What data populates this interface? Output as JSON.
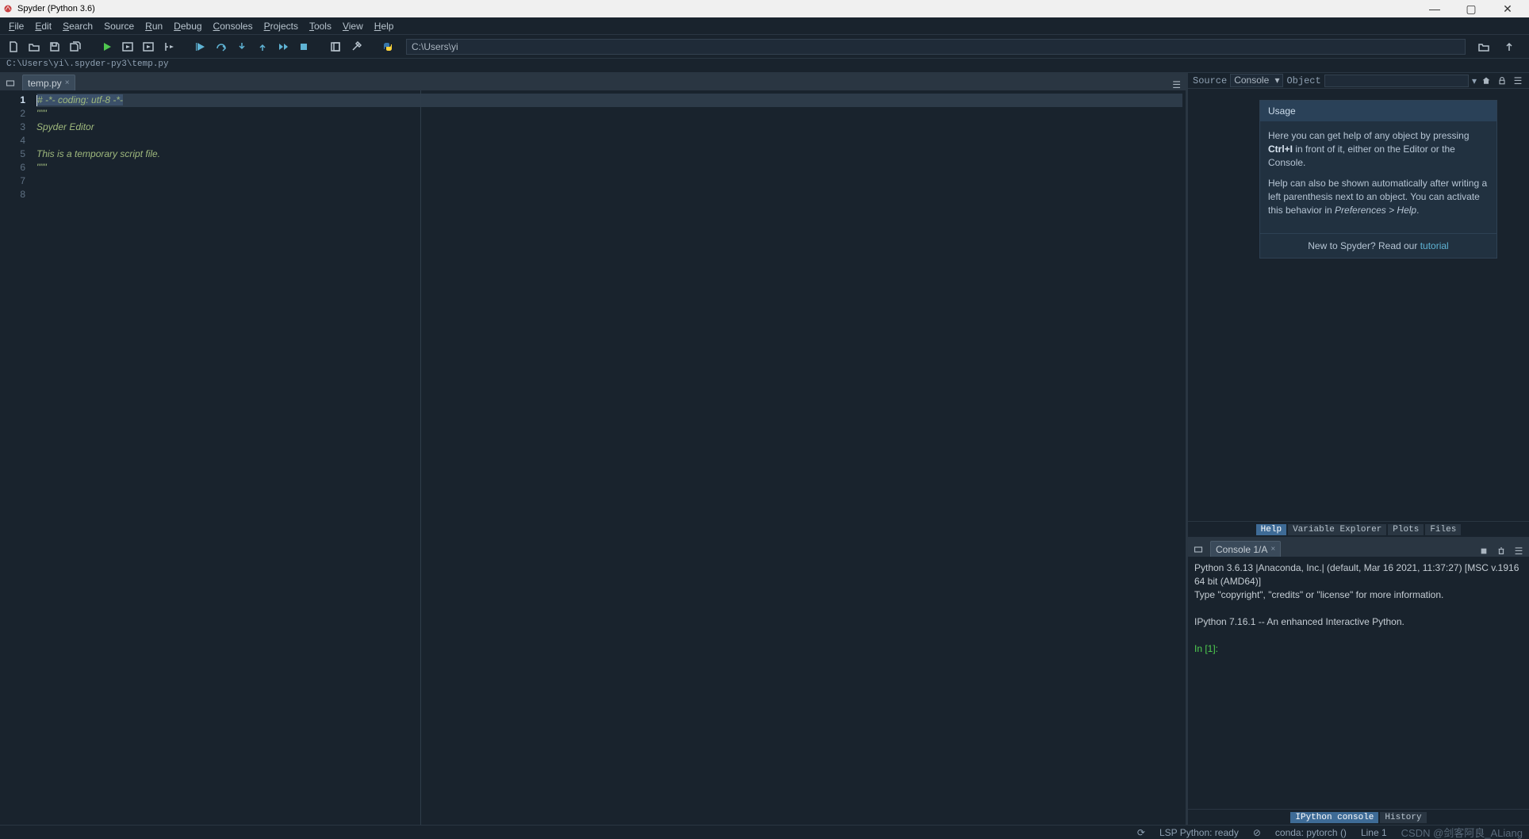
{
  "window": {
    "title": "Spyder (Python 3.6)",
    "minimize_label": "—",
    "maximize_label": "▢",
    "close_label": "✕"
  },
  "menubar": [
    {
      "key": "F",
      "rest": "ile"
    },
    {
      "key": "E",
      "rest": "dit"
    },
    {
      "key": "S",
      "rest": "earch"
    },
    {
      "key": "",
      "rest": "Source"
    },
    {
      "key": "R",
      "rest": "un"
    },
    {
      "key": "D",
      "rest": "ebug"
    },
    {
      "key": "C",
      "rest": "onsoles"
    },
    {
      "key": "P",
      "rest": "rojects"
    },
    {
      "key": "T",
      "rest": "ools"
    },
    {
      "key": "V",
      "rest": "iew"
    },
    {
      "key": "H",
      "rest": "elp"
    }
  ],
  "toolbar": {
    "working_dir": "C:\\Users\\yi"
  },
  "current_file_path": "C:\\Users\\yi\\.spyder-py3\\temp.py",
  "editor": {
    "tab_label": "temp.py",
    "tab_close": "×",
    "line_numbers": [
      "1",
      "2",
      "3",
      "4",
      "5",
      "6",
      "7",
      "8"
    ],
    "lines": [
      "# -*- coding: utf-8 -*-",
      "\"\"\"",
      "Spyder Editor",
      "",
      "This is a temporary script file.",
      "\"\"\"",
      "",
      ""
    ]
  },
  "help": {
    "source_label": "Source",
    "source_value": "Console",
    "object_label": "Object",
    "usage_title": "Usage",
    "usage_text1_pre": "Here you can get help of any object by pressing ",
    "usage_text1_key": "Ctrl+I",
    "usage_text1_post": " in front of it, either on the Editor or the Console.",
    "usage_text2_pre": "Help can also be shown automatically after writing a left parenthesis next to an object. You can activate this behavior in ",
    "usage_text2_pref": "Preferences > Help",
    "usage_text2_end": ".",
    "footer_pre": "New to Spyder? Read our ",
    "footer_link": "tutorial",
    "tabs": [
      "Help",
      "Variable Explorer",
      "Plots",
      "Files"
    ]
  },
  "console": {
    "tab_label": "Console 1/A",
    "tab_close": "×",
    "output_lines": [
      "Python 3.6.13 |Anaconda, Inc.| (default, Mar 16 2021, 11:37:27) [MSC v.1916 64 bit (AMD64)]",
      "Type \"copyright\", \"credits\" or \"license\" for more information.",
      "",
      "IPython 7.16.1 -- An enhanced Interactive Python.",
      ""
    ],
    "prompt": "In [1]: ",
    "tabs": [
      "IPython console",
      "History"
    ]
  },
  "status": {
    "lsp": "LSP Python: ready",
    "env": "conda: pytorch ()",
    "line": "Line 1",
    "watermark": "CSDN @剑客阿良_ALiang"
  }
}
